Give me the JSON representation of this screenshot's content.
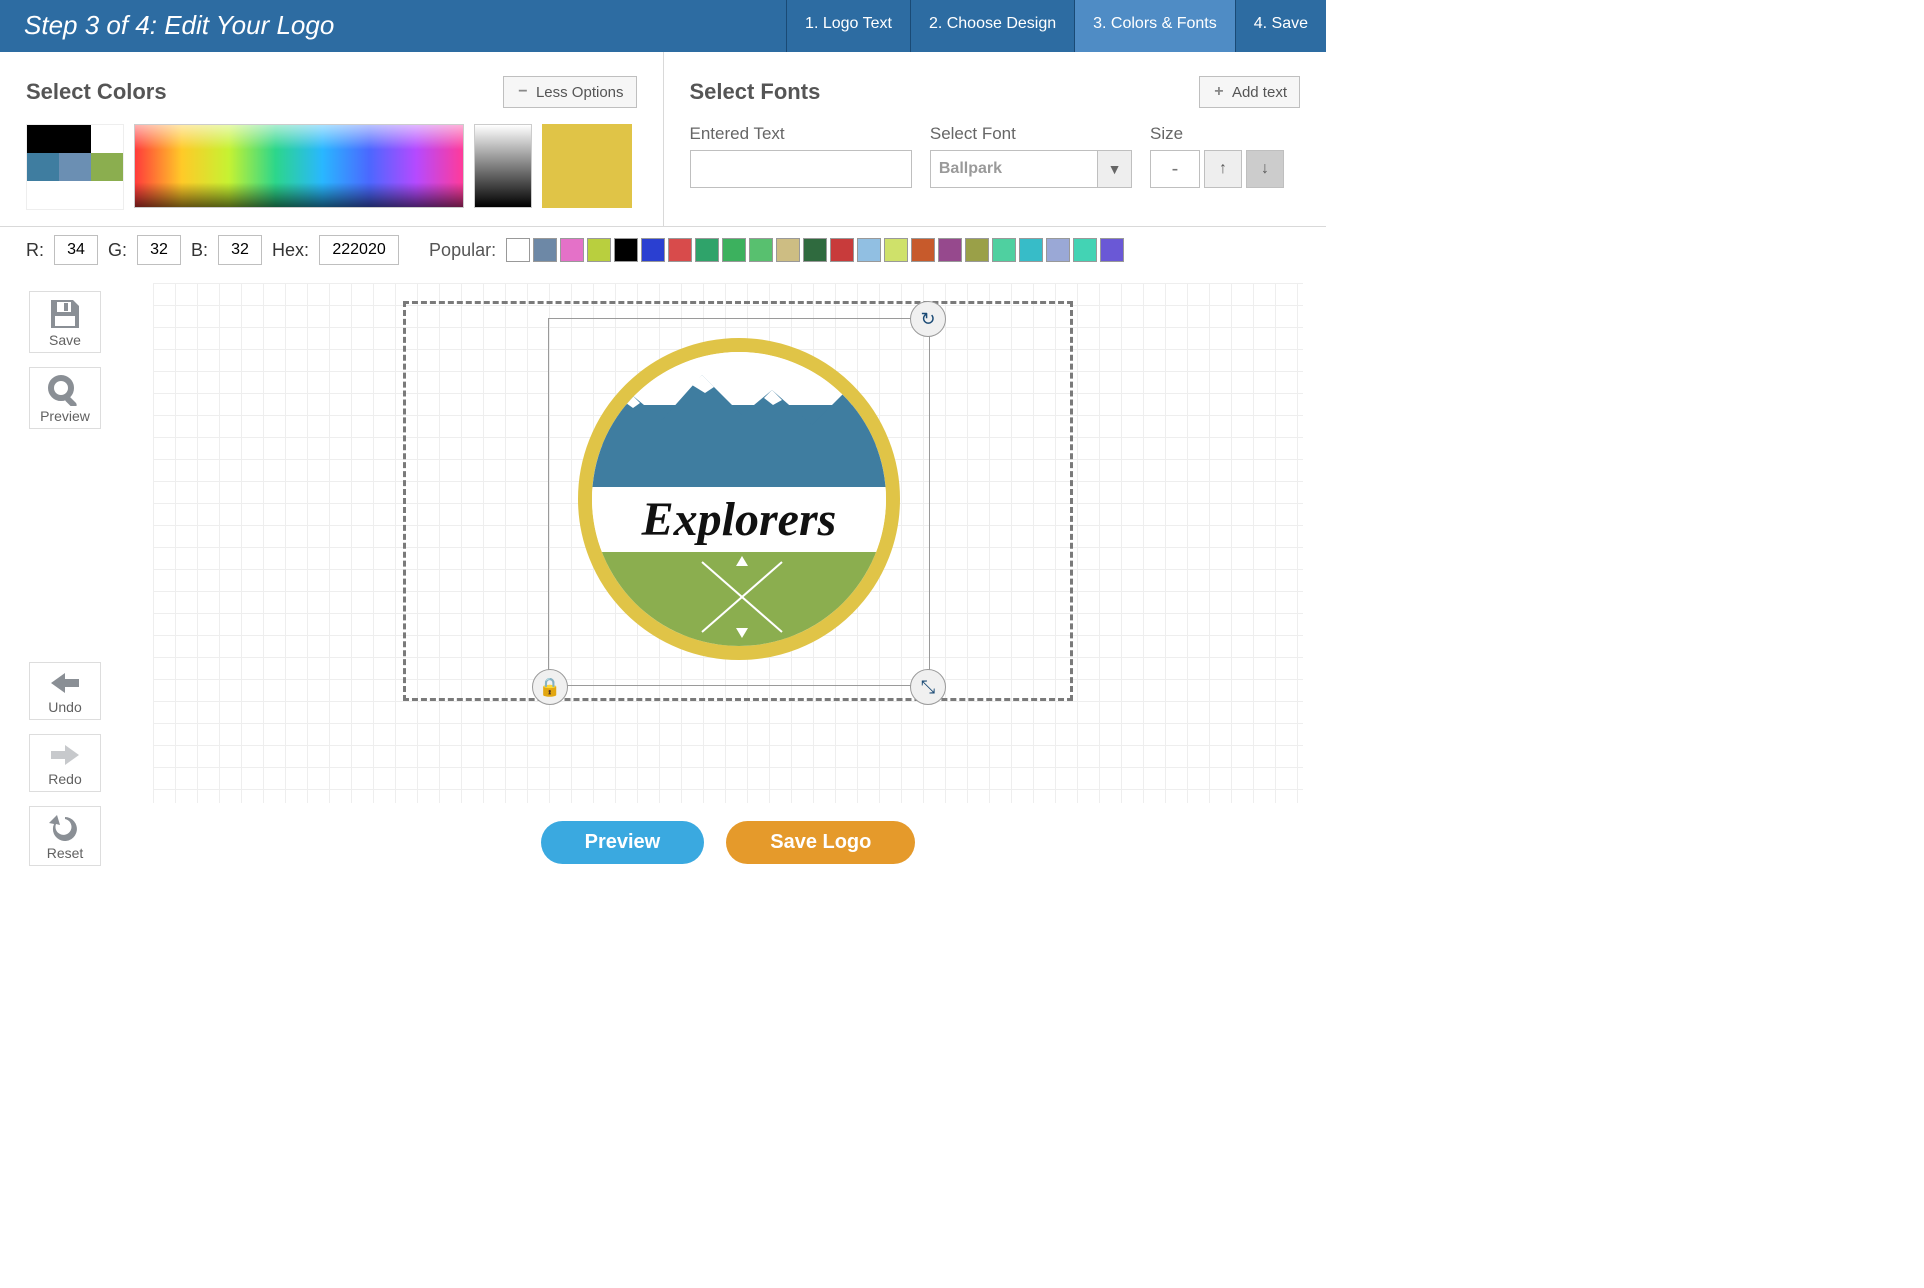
{
  "header": {
    "title": "Step 3 of 4: Edit Your Logo",
    "tabs": [
      {
        "label": "1. Logo Text"
      },
      {
        "label": "2. Choose Design"
      },
      {
        "label": "3. Colors & Fonts"
      },
      {
        "label": "4. Save"
      }
    ]
  },
  "colors_panel": {
    "title": "Select Colors",
    "less_options": "Less Options",
    "current_swatch": "#e0c447",
    "palette": [
      "#000000",
      "#000000",
      "#ffffff",
      "#3f7da0",
      "#6b8fb3",
      "#8bae4f",
      "#ffffff",
      "#ffffff",
      "#ffffff"
    ]
  },
  "fonts_panel": {
    "title": "Select Fonts",
    "add_text": "Add text",
    "entered_text_label": "Entered Text",
    "entered_text_value": "",
    "select_font_label": "Select Font",
    "select_font_value": "Ballpark",
    "size_label": "Size",
    "size_value": "-"
  },
  "rgb": {
    "r_label": "R:",
    "r_value": "34",
    "g_label": "G:",
    "g_value": "32",
    "b_label": "B:",
    "b_value": "32",
    "hex_label": "Hex:",
    "hex_value": "222020",
    "popular_label": "Popular:",
    "popular_colors": [
      "#ffffff",
      "#6d88a6",
      "#e471c8",
      "#b9cf3e",
      "#000000",
      "#2a3fd1",
      "#d84b4b",
      "#2fa36a",
      "#3cb15e",
      "#58c06f",
      "#cdbd83",
      "#2f6a3e",
      "#c83b3b",
      "#91bfe2",
      "#cfe16a",
      "#c75a2b",
      "#96498d",
      "#9aa048",
      "#4fd0a0",
      "#37bcc8",
      "#9aa8d6",
      "#43d3b4",
      "#6a58d6"
    ]
  },
  "sidebar": {
    "save": "Save",
    "preview": "Preview",
    "undo": "Undo",
    "redo": "Redo",
    "reset": "Reset"
  },
  "canvas": {
    "logo_text": "Explorers"
  },
  "actions": {
    "preview": "Preview",
    "save_logo": "Save Logo"
  }
}
